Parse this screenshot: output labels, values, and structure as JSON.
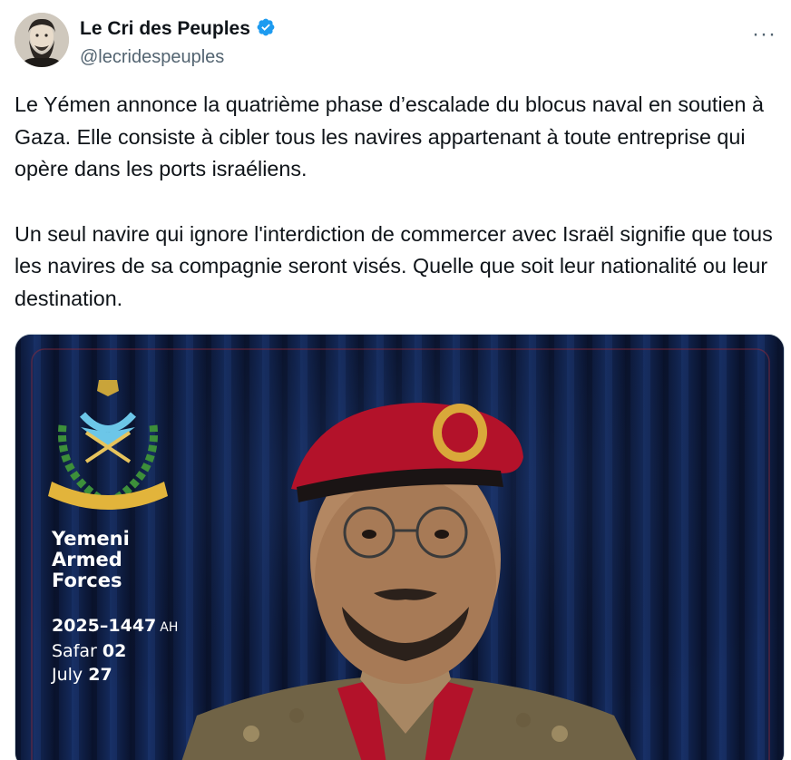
{
  "author": {
    "display_name": "Le Cri des Peuples",
    "handle": "@lecridespeuples",
    "verified_icon": "verified-badge-icon",
    "avatar_icon": "avatar-portrait",
    "more_label": "···"
  },
  "tweet": {
    "paragraph_1": "Le Yémen annonce la quatrième phase d’escalade du blocus naval en soutien à Gaza. Elle consiste à cibler tous les navires appartenant à toute entreprise qui opère dans les ports israéliens.",
    "paragraph_2": "Un seul navire qui ignore l'interdiction de commercer avec Israël signifie que tous les navires de sa compagnie seront visés. Quelle que soit leur nationalité ou leur destination."
  },
  "media": {
    "emblem_icon": "yemeni-armed-forces-emblem",
    "title_line_1": "Yemeni",
    "title_line_2": "Armed",
    "title_line_3": "Forces",
    "date_year": "2025–1447",
    "date_ah": "AH",
    "date_month_hijri": "Safar",
    "date_day_hijri": "02",
    "date_month": "July",
    "date_day": "27"
  },
  "colors": {
    "accent_blue": "#1d9bf0",
    "text_primary": "#0f1419",
    "text_secondary": "#536471",
    "card_background": "#0c1630",
    "beret_red": "#b3122a"
  }
}
